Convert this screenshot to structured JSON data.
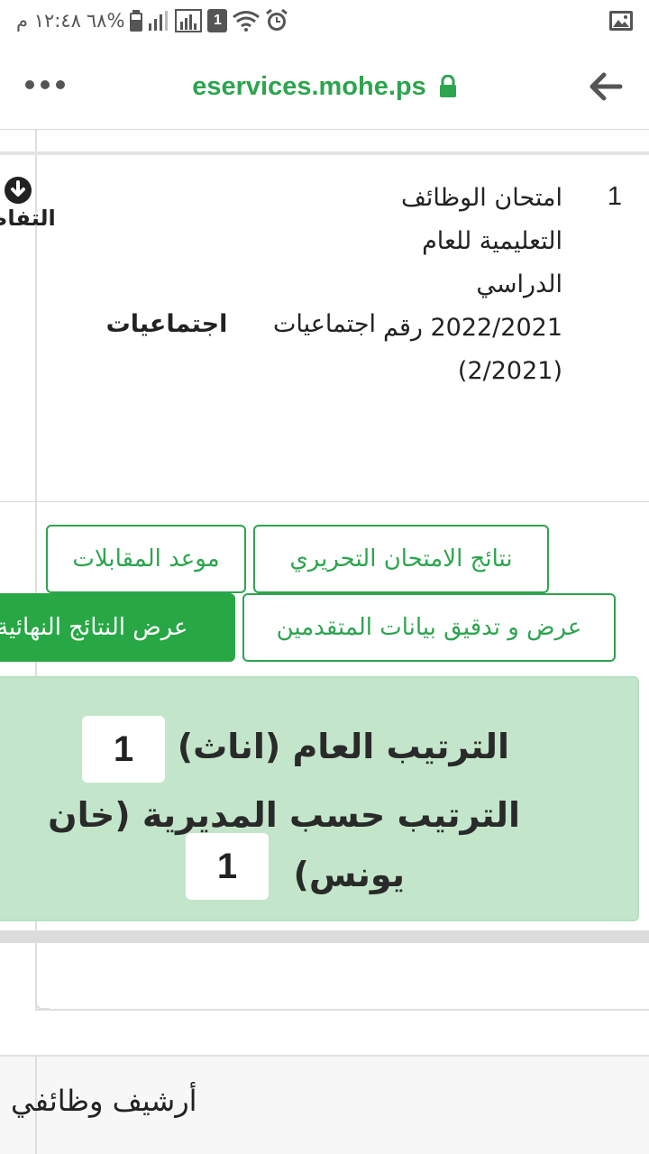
{
  "status_bar": {
    "time": "١٢:٤٨ م",
    "battery": "٦٨%",
    "notification_count": "1"
  },
  "browser": {
    "url": "eservices.mohe.ps"
  },
  "exam_row": {
    "number": "1",
    "name": "امتحان الوظائف التعليمية للعام الدراسي 2022/2021 رقم (2/2021)",
    "department": "اجتماعيات",
    "specialization": "اجتماعيات",
    "details": "التفاصيل"
  },
  "actions": {
    "written_results": "نتائج الامتحان التحريري",
    "interview_date": "موعد المقابلات",
    "review_data": "عرض و تدقيق بيانات المتقدمين",
    "final_results": "عرض النتائج النهائية"
  },
  "ranking": {
    "general_label": "الترتيب العام (اناث)",
    "general_value": "1",
    "directorate_label_1": "الترتيب حسب المديرية (خان",
    "directorate_label_2": "يونس)",
    "directorate_value": "1"
  },
  "archive": {
    "title": "أرشيف وظائفي"
  },
  "colors": {
    "brand_green": "#2ea44f",
    "button_fill": "#28a745",
    "success_bg": "#c3e6cb"
  },
  "icons": [
    "image-icon",
    "alarm-icon",
    "wifi-icon",
    "sim-icon",
    "signal-icon",
    "battery-icon",
    "lock-icon",
    "back-arrow-icon",
    "more-icon",
    "download-icon"
  ]
}
